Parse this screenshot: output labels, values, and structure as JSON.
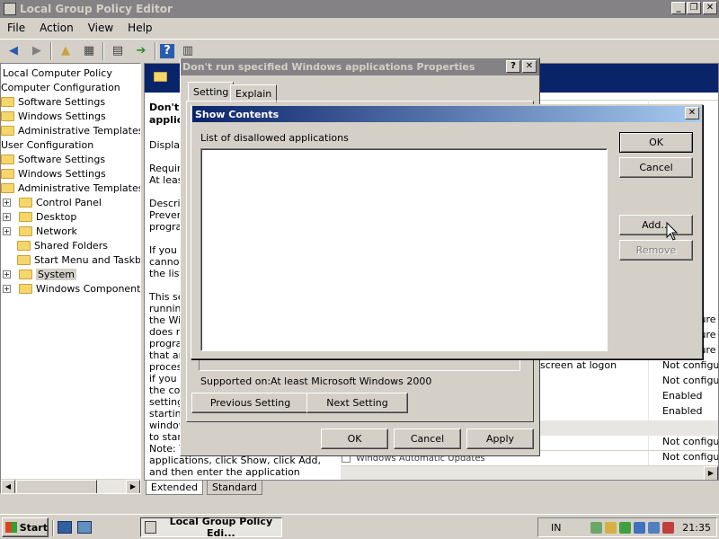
{
  "window": {
    "title": "Local Group Policy Editor"
  },
  "menu": [
    "File",
    "Action",
    "View",
    "Help"
  ],
  "tree": [
    {
      "label": "Local Computer Policy",
      "indent": 0
    },
    {
      "label": "Computer Configuration",
      "indent": 0
    },
    {
      "label": "Software Settings",
      "indent": 1
    },
    {
      "label": "Windows Settings",
      "indent": 1
    },
    {
      "label": "Administrative Templates",
      "indent": 1
    },
    {
      "label": "User Configuration",
      "indent": 0
    },
    {
      "label": "Software Settings",
      "indent": 1
    },
    {
      "label": "Windows Settings",
      "indent": 1
    },
    {
      "label": "Administrative Templates",
      "indent": 1
    },
    {
      "label": "Control Panel",
      "indent": 2
    },
    {
      "label": "Desktop",
      "indent": 2
    },
    {
      "label": "Network",
      "indent": 2
    },
    {
      "label": "Shared Folders",
      "indent": 2
    },
    {
      "label": "Start Menu and Taskbar",
      "indent": 2
    },
    {
      "label": "System",
      "indent": 2
    },
    {
      "label": "Windows Components",
      "indent": 2
    }
  ],
  "description": {
    "title_line1": "Don't",
    "title_line2": "applic",
    "lines": [
      "Display",
      "",
      "Require",
      "At leas",
      "",
      "Descrip",
      "Preven",
      "progra",
      "",
      "If you",
      "cannot",
      "the list",
      "",
      "This se",
      "running",
      "the Wi",
      "does n",
      "progra",
      "that ar",
      "proces",
      "if you p",
      "the co",
      "setting",
      "startin",
      "window",
      "to star",
      "Note: T",
      "applications, click Show, click Add,",
      "and then enter the application"
    ]
  },
  "policy_list": {
    "rows": [
      {
        "name": "",
        "state": "t configure"
      },
      {
        "name": "",
        "state": "t configure"
      },
      {
        "name": "",
        "state": "t configure"
      },
      {
        "name": "screen at logon",
        "state": "Not configure"
      },
      {
        "name": "",
        "state": "Not configure"
      },
      {
        "name": "",
        "state": "Enabled"
      },
      {
        "name": "",
        "state": "Enabled"
      },
      {
        "name": "",
        "state": "Not configure"
      },
      {
        "name": "",
        "state": "Not configure"
      },
      {
        "name": "",
        "state": "Not configure"
      }
    ],
    "partial_row": "Windows Automatic Updates"
  },
  "view_tabs": [
    "Extended",
    "Standard"
  ],
  "properties_dialog": {
    "title": "Don't run specified Windows applications Properties",
    "tabs": [
      "Setting",
      "Explain"
    ],
    "supported_label": "Supported on:",
    "supported_value": "At least Microsoft Windows 2000",
    "previous_setting": "Previous Setting",
    "next_setting": "Next Setting",
    "ok": "OK",
    "cancel": "Cancel",
    "apply": "Apply"
  },
  "show_contents": {
    "title": "Show Contents",
    "list_label": "List of disallowed applications",
    "ok": "OK",
    "cancel": "Cancel",
    "add": "Add...",
    "remove": "Remove"
  },
  "taskbar": {
    "start": "Start",
    "task": "Local Group Policy Edi...",
    "lang": "IN",
    "time": "21:35"
  },
  "colors": {
    "active_title": "#0a246a",
    "inactive_title": "#848284",
    "face": "#d4d0c8"
  }
}
